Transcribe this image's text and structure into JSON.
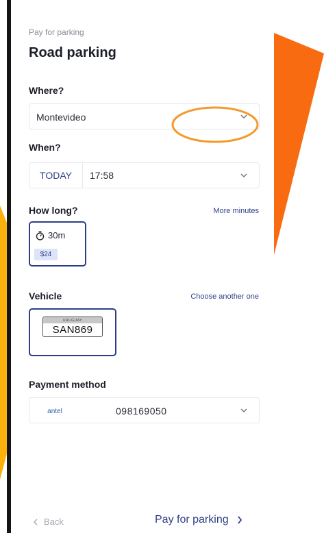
{
  "header": {
    "overline": "Pay for parking",
    "title": "Road parking"
  },
  "where": {
    "label": "Where?",
    "value": "Montevideo"
  },
  "when": {
    "label": "When?",
    "today_label": "TODAY",
    "time": "17:58"
  },
  "how_long": {
    "label": "How long?",
    "more_link": "More minutes",
    "selected_duration": "30m",
    "selected_price": "$24"
  },
  "vehicle": {
    "label": "Vehicle",
    "choose_link": "Choose another one",
    "plate_country": "URUGUAY",
    "plate_number": "SAN869"
  },
  "payment": {
    "label": "Payment method",
    "provider": "antel",
    "phone": "098169050"
  },
  "footer": {
    "back_label": "Back",
    "pay_label": "Pay for parking"
  },
  "colors": {
    "accent": "#2c3f86",
    "orange": "#f86b10",
    "yellow": "#fbb00c"
  }
}
